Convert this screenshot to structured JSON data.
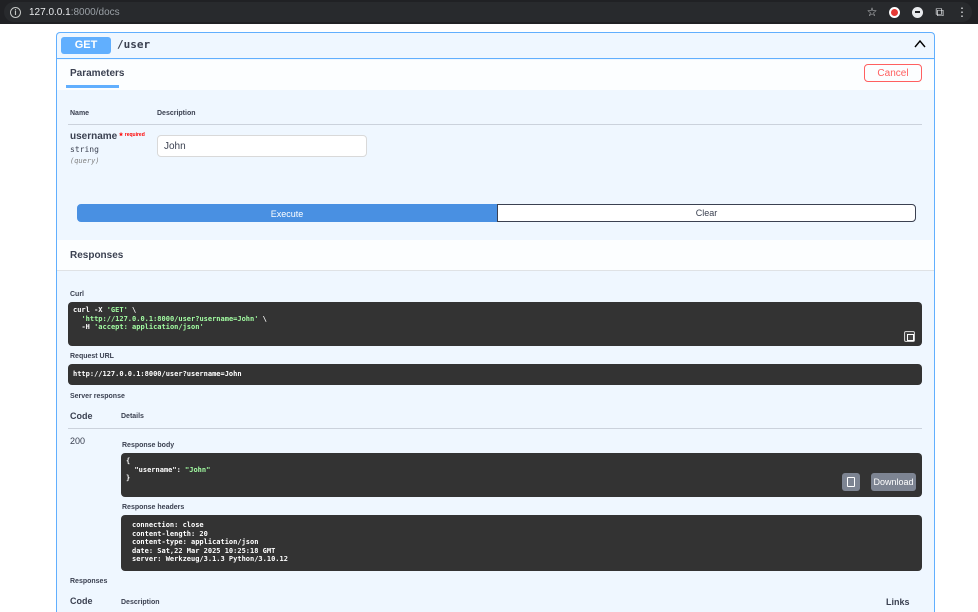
{
  "browser": {
    "url_host": "127.0.0.1",
    "url_path": ":8000/docs"
  },
  "operation": {
    "method": "GET",
    "path": "/user"
  },
  "parameters": {
    "tab_label": "Parameters",
    "cancel_label": "Cancel",
    "col_name": "Name",
    "col_description": "Description",
    "items": [
      {
        "name": "username",
        "required_star": "*",
        "required_label": "required",
        "type": "string",
        "in": "(query)",
        "value": "John"
      }
    ]
  },
  "actions": {
    "execute_label": "Execute",
    "clear_label": "Clear"
  },
  "responses": {
    "title": "Responses",
    "curl_label": "Curl",
    "curl": {
      "line1_cmd": "curl -X ",
      "line1_method": "'GET'",
      "line1_tail": " \\",
      "line2_url": "'http://127.0.0.1:8000/user?username=John'",
      "line2_tail": " \\",
      "line3_flag": "-H ",
      "line3_header": "'accept: application/json'"
    },
    "request_url_label": "Request URL",
    "request_url": "http://127.0.0.1:8000/user?username=John",
    "server_response_label": "Server response",
    "col_code": "Code",
    "col_details": "Details",
    "status_code": "200",
    "response_body_label": "Response body",
    "response_body": {
      "open": "{",
      "key": "\"username\"",
      "colon": ": ",
      "value": "\"John\"",
      "close": "}"
    },
    "download_label": "Download",
    "response_headers_label": "Response headers",
    "response_headers": [
      "connection: close",
      "content-length: 20",
      "content-type: application/json",
      "date: Sat,22 Mar 2025 10:25:18 GMT",
      "server: Werkzeug/3.1.3 Python/3.10.12"
    ],
    "footer_title": "Responses",
    "footer_code": "Code",
    "footer_description": "Description",
    "footer_links": "Links"
  }
}
